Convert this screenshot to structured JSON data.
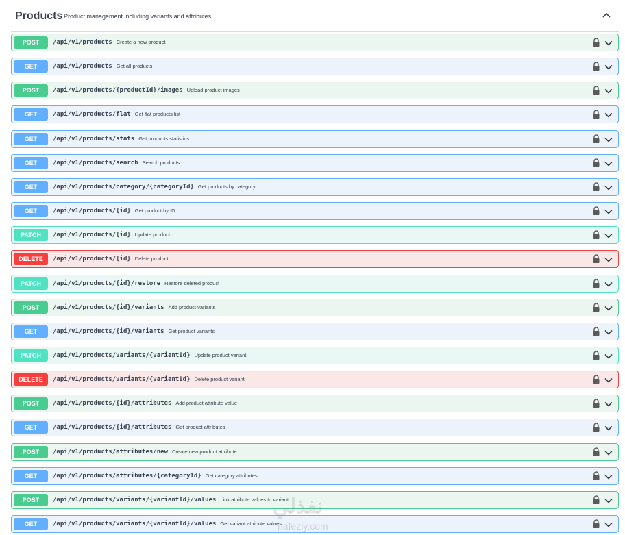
{
  "tag": {
    "name": "Products",
    "description": "Product management including variants and attributes"
  },
  "operations": [
    {
      "method": "POST",
      "path": "/api/v1/products",
      "summary": "Create a new product"
    },
    {
      "method": "GET",
      "path": "/api/v1/products",
      "summary": "Get all products"
    },
    {
      "method": "POST",
      "path": "/api/v1/products/{productId}/images",
      "summary": "Upload product images"
    },
    {
      "method": "GET",
      "path": "/api/v1/products/flat",
      "summary": "Get flat products list"
    },
    {
      "method": "GET",
      "path": "/api/v1/products/stats",
      "summary": "Get products statistics"
    },
    {
      "method": "GET",
      "path": "/api/v1/products/search",
      "summary": "Search products"
    },
    {
      "method": "GET",
      "path": "/api/v1/products/category/{categoryId}",
      "summary": "Get products by category"
    },
    {
      "method": "GET",
      "path": "/api/v1/products/{id}",
      "summary": "Get product by ID"
    },
    {
      "method": "PATCH",
      "path": "/api/v1/products/{id}",
      "summary": "Update product"
    },
    {
      "method": "DELETE",
      "path": "/api/v1/products/{id}",
      "summary": "Delete product"
    },
    {
      "method": "PATCH",
      "path": "/api/v1/products/{id}/restore",
      "summary": "Restore deleted product"
    },
    {
      "method": "POST",
      "path": "/api/v1/products/{id}/variants",
      "summary": "Add product variants"
    },
    {
      "method": "GET",
      "path": "/api/v1/products/{id}/variants",
      "summary": "Get product variants"
    },
    {
      "method": "PATCH",
      "path": "/api/v1/products/variants/{variantId}",
      "summary": "Update product variant"
    },
    {
      "method": "DELETE",
      "path": "/api/v1/products/variants/{variantId}",
      "summary": "Delete product variant"
    },
    {
      "method": "POST",
      "path": "/api/v1/products/{id}/attributes",
      "summary": "Add product attribute value"
    },
    {
      "method": "GET",
      "path": "/api/v1/products/{id}/attributes",
      "summary": "Get product attributes"
    },
    {
      "method": "POST",
      "path": "/api/v1/products/attributes/new",
      "summary": "Create new product attribute"
    },
    {
      "method": "GET",
      "path": "/api/v1/products/attributes/{categoryId}",
      "summary": "Get category attributes"
    },
    {
      "method": "POST",
      "path": "/api/v1/products/variants/{variantId}/values",
      "summary": "Link attribute values to variant"
    },
    {
      "method": "GET",
      "path": "/api/v1/products/variants/{variantId}/values",
      "summary": "Get variant attribute values"
    }
  ],
  "icons": {
    "lock": "lock-icon",
    "expand": "chevron-down-icon",
    "collapse": "chevron-up-icon"
  },
  "colors": {
    "post": "#49cc90",
    "get": "#61affe",
    "patch": "#50e3c2",
    "delete": "#f93e3e"
  },
  "watermark": {
    "text": "نفذلي",
    "subtext": "nafezly.com"
  }
}
